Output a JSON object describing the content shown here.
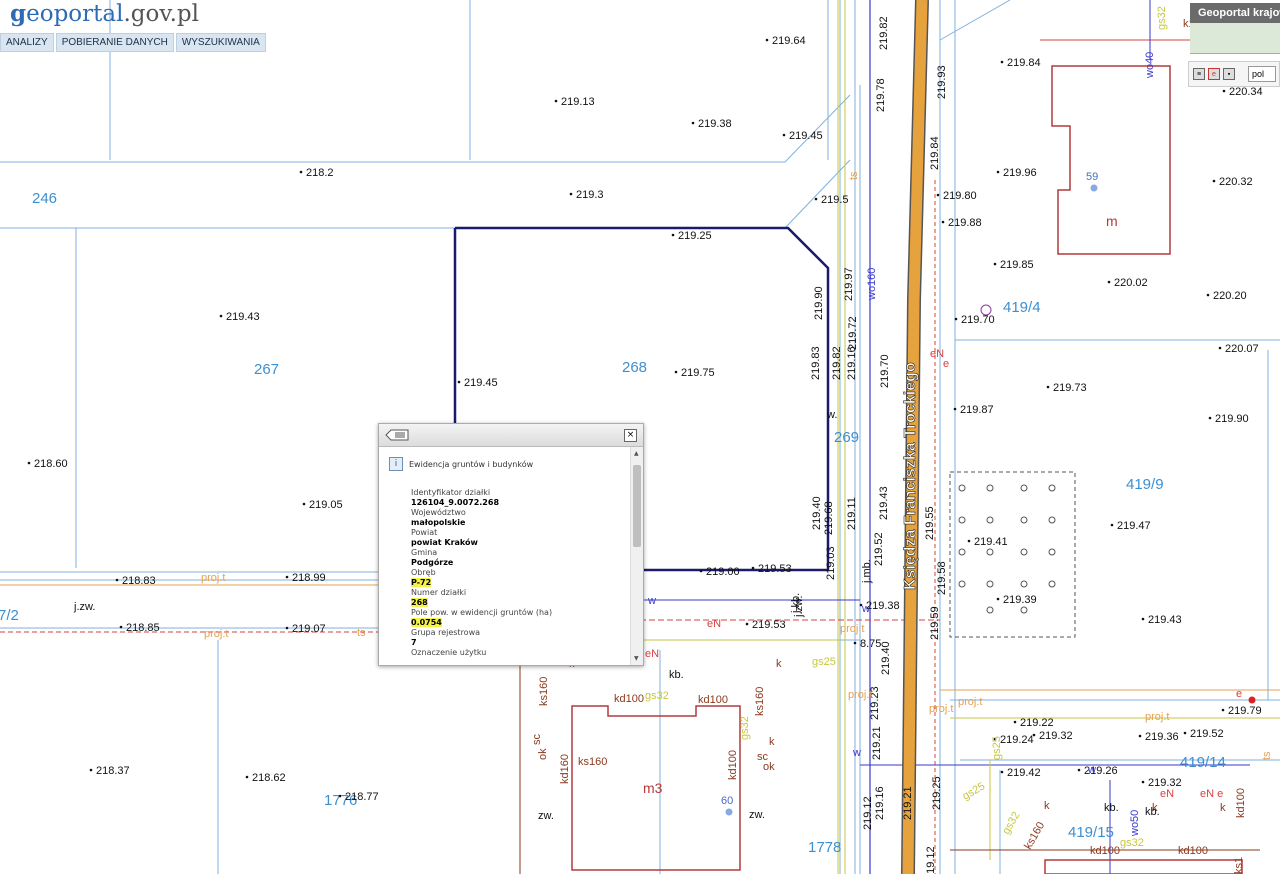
{
  "site": {
    "logo_g": "g",
    "logo_eo": "eo",
    "logo_portal": "portal",
    "logo_domain": ".gov.pl"
  },
  "menu": [
    {
      "label": "ANALIZY"
    },
    {
      "label": "POBIERANIE DANYCH"
    },
    {
      "label": "WYSZUKIWANIA"
    }
  ],
  "overview": {
    "title": "Geoportal krajowy",
    "language": "pol"
  },
  "popup": {
    "section": "Ewidencja gruntów i budynków",
    "attributes": [
      {
        "label": "Identyfikator działki",
        "value": "126104_9.0072.268",
        "highlight": false
      },
      {
        "label": "Województwo",
        "value": "małopolskie",
        "highlight": false
      },
      {
        "label": "Powiat",
        "value": "powiat Kraków",
        "highlight": false
      },
      {
        "label": "Gmina",
        "value": "Podgórze",
        "highlight": false
      },
      {
        "label": "Obręb",
        "value": "P-72",
        "highlight": true
      },
      {
        "label": "Numer działki",
        "value": "268",
        "highlight": true
      },
      {
        "label": "Pole pow. w ewidencji gruntów (ha)",
        "value": "0.0754",
        "highlight": true
      },
      {
        "label": "Grupa rejestrowa",
        "value": "7",
        "highlight": false
      },
      {
        "label": "Oznaczenie użytku",
        "value": "",
        "highlight": false
      }
    ]
  },
  "map": {
    "colors": {
      "parcel_line": "#7fb1df",
      "parcel_label": "#3d8fd0",
      "selection": "#1b1a6c",
      "road": "#e6a23c",
      "building": "#b23a3a",
      "elevation": "#111111",
      "gas": "#c7c740",
      "power": "#d94040",
      "water": "#3a3acd",
      "sewer": "#8a3a1e",
      "projection": "#e6a050"
    },
    "parcels": [
      "246",
      "267",
      "268",
      "269",
      "419/4",
      "419/9",
      "419/14",
      "419/15",
      "1776",
      "1778",
      "7/2"
    ],
    "buildings": [
      "m",
      "m3"
    ],
    "building_numbers": [
      "59",
      "60"
    ],
    "street": "Księdza Franciszka Trockiego",
    "elevations": [
      "219.64",
      "219.13",
      "219.38",
      "219.45",
      "218.2",
      "219.3",
      "219.5",
      "219.25",
      "219.43",
      "219.75",
      "219.45",
      "218.60",
      "219.05",
      "218.83",
      "218.99",
      "218.85",
      "219.07",
      "219.00",
      "219.53",
      "219.53",
      "218.37",
      "218.62",
      "218.77",
      "219.84",
      "220.34",
      "219.96",
      "220.32",
      "219.80",
      "219.88",
      "219.85",
      "220.02",
      "220.20",
      "219.70",
      "220.07",
      "219.73",
      "219.87",
      "219.90",
      "219.47",
      "219.41",
      "219.39",
      "219.43",
      "219.79",
      "219.22",
      "219.24",
      "219.32",
      "219.36",
      "219.52",
      "219.42",
      "219.26",
      "219.32",
      "219.82",
      "219.78",
      "219.93",
      "219.84",
      "219.90",
      "219.83",
      "219.82",
      "219.70",
      "219.40",
      "219.43",
      "219.52",
      "219.38",
      "219.40",
      "219.23",
      "219.21",
      "219.12",
      "219.16",
      "219.21",
      "219.25",
      "219.12",
      "219.55",
      "219.58",
      "219.59",
      "219.16",
      "219.11",
      "219.68",
      "219.03",
      "219.97",
      "219.72",
      "8.75"
    ],
    "utility_labels": [
      "j.zw.",
      "j.zw.",
      "j.kb.",
      "j.mb.",
      "w.",
      "w",
      "w",
      "w",
      "w",
      "eN",
      "eN",
      "eN",
      "eN",
      "eN",
      "eN e",
      "e",
      "e",
      "ts",
      "ts",
      "ts",
      "proj.t",
      "proj.t",
      "proj.t",
      "proj.t",
      "proj.t",
      "proj.t",
      "proj.t",
      "gs32",
      "gs32",
      "gs32",
      "gs32",
      "gs25",
      "gs25",
      "gs25",
      "wo160",
      "wo40",
      "wo50",
      "ks160",
      "ks160",
      "ks160",
      "ks160",
      "ks1",
      "kd100",
      "kd100",
      "kd100",
      "kd160",
      "kd100",
      "kd100",
      "kd100",
      "k",
      "k",
      "k",
      "k",
      "k",
      "k",
      "kb.",
      "kb.",
      "kb.",
      "sc",
      "ok",
      "sc",
      "ok",
      "zw.",
      "zw.",
      "ie",
      "k1",
      "gs32"
    ]
  }
}
